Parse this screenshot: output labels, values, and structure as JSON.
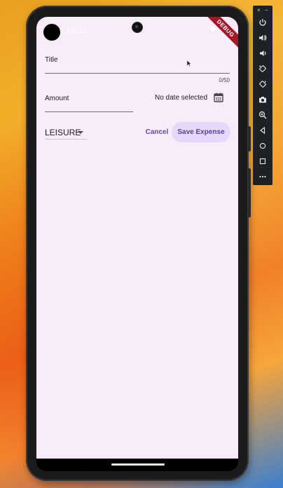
{
  "status_bar": {
    "time": "10:12"
  },
  "debug_banner": "DEBUG",
  "form": {
    "title_label": "Title",
    "title_value": "",
    "title_counter": "0/50",
    "amount_label": "Amount",
    "amount_value": "",
    "date_text": "No date selected",
    "category": "LEISURE",
    "cancel_label": "Cancel",
    "save_label": "Save Expense"
  },
  "colors": {
    "screen_background": "#f8ecfb",
    "accent": "#6a4aa7",
    "save_button_fill": "#e6d8f8",
    "debug_banner": "#a4162a"
  },
  "emulator_toolbar": {
    "window_controls": [
      "×",
      "−"
    ],
    "buttons": [
      "power-icon",
      "volume-up-icon",
      "volume-down-icon",
      "rotate-left-icon",
      "rotate-right-icon",
      "camera-icon",
      "zoom-icon",
      "back-icon",
      "home-icon",
      "overview-icon",
      "more-icon"
    ]
  }
}
